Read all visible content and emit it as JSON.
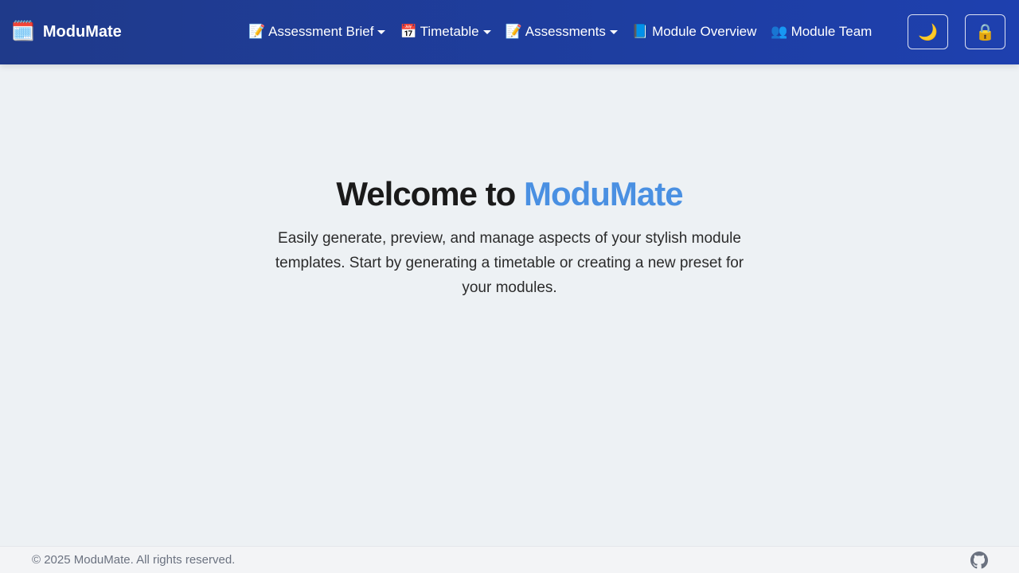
{
  "header": {
    "brand": {
      "icon": "calendar-robot-emoji",
      "emoji": "🗓️",
      "name": "ModuMate"
    },
    "nav": [
      {
        "emoji": "📝",
        "label": "Assessment Brief",
        "dropdown": true
      },
      {
        "emoji": "📅",
        "label": "Timetable",
        "dropdown": true
      },
      {
        "emoji": "📝",
        "label": "Assessments",
        "dropdown": true
      },
      {
        "emoji": "📘",
        "label": "Module Overview",
        "dropdown": false
      },
      {
        "emoji": "👥",
        "label": "Module Team",
        "dropdown": false
      }
    ],
    "theme_toggle": {
      "icon": "moon-icon",
      "glyph": "🌙"
    },
    "lock_button": {
      "icon": "lock-icon",
      "glyph": "🔒"
    }
  },
  "hero": {
    "title_prefix": "Welcome to",
    "title_accent": "ModuMate",
    "description": "Easily generate, preview, and manage aspects of your stylish module templates. Start by generating a timetable or creating a new preset for your modules."
  },
  "footer": {
    "copyright": "© 2025 ModuMate. All rights reserved.",
    "github_icon": "github-icon"
  },
  "colors": {
    "navbar": "#1e40af",
    "accent": "#4a90e2",
    "background": "#edf1f4"
  }
}
